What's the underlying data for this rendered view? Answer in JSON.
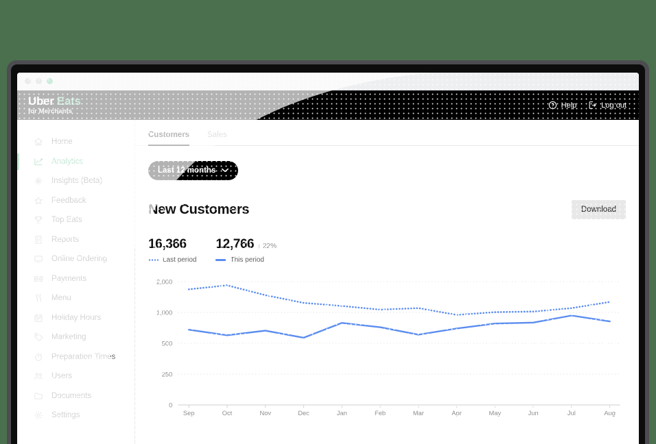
{
  "window": {
    "dots": [
      "window-dot-close",
      "window-dot-minimize",
      "window-dot-maximize"
    ]
  },
  "topbar": {
    "brand_uber": "Uber",
    "brand_eats": "Eats",
    "brand_sub": "for Merchants",
    "help_label": "Help",
    "logout_label": "Log out"
  },
  "sidebar": {
    "items": [
      {
        "label": "Home",
        "icon": "home-icon",
        "active": false
      },
      {
        "label": "Analytics",
        "icon": "analytics-icon",
        "active": true
      },
      {
        "label": "Insights (Beta)",
        "icon": "sparkle-icon",
        "active": false
      },
      {
        "label": "Feedback",
        "icon": "star-icon",
        "active": false
      },
      {
        "label": "Top Eats",
        "icon": "trophy-icon",
        "active": false
      },
      {
        "label": "Reports",
        "icon": "report-icon",
        "active": false
      },
      {
        "label": "Online Ordering",
        "icon": "monitor-icon",
        "active": false
      },
      {
        "label": "Payments",
        "icon": "cash-icon",
        "active": false
      },
      {
        "label": "Menu",
        "icon": "cutlery-icon",
        "active": false
      },
      {
        "label": "Holiday Hours",
        "icon": "calendar-icon",
        "active": false
      },
      {
        "label": "Marketing",
        "icon": "tag-icon",
        "active": false
      },
      {
        "label": "Preparation Times",
        "icon": "stopwatch-icon",
        "active": false
      },
      {
        "label": "Users",
        "icon": "users-icon",
        "active": false
      },
      {
        "label": "Documents",
        "icon": "folder-icon",
        "active": false
      },
      {
        "label": "Settings",
        "icon": "gear-icon",
        "active": false
      }
    ]
  },
  "main": {
    "tabs": [
      {
        "label": "Customers",
        "active": true
      },
      {
        "label": "Sales",
        "active": false
      }
    ],
    "period_selector": "Last 12 months",
    "page_title": "New Customers",
    "download_label": "Download",
    "stats": [
      {
        "value": "16,366",
        "delta": "",
        "legend": "Last period",
        "style": "dotted"
      },
      {
        "value": "12,766",
        "delta": "↓ 22%",
        "legend": "This period",
        "style": "solid"
      }
    ]
  },
  "colors": {
    "brand_green": "#3fae6f",
    "series_blue": "#5b8def",
    "page_background": "#4a704e",
    "topbar_black": "#000000"
  },
  "chart_data": {
    "type": "line",
    "title": "New Customers",
    "xlabel": "",
    "ylabel": "",
    "grid": true,
    "legend_position": "top-left",
    "categories": [
      "Sep",
      "Oct",
      "Nov",
      "Dec",
      "Jan",
      "Feb",
      "Mar",
      "Apr",
      "May",
      "Jun",
      "Jul",
      "Aug"
    ],
    "y_ticks": [
      0,
      250,
      500,
      1000,
      2000
    ],
    "y_tick_labels": [
      "0",
      "250",
      "500",
      "1,000",
      "2,000"
    ],
    "ylim": [
      0,
      2200
    ],
    "y_scale": "piecewise",
    "series": [
      {
        "name": "Last period",
        "style": "dotted",
        "color": "#5b8def",
        "total": "16,366",
        "values": [
          1750,
          1880,
          1560,
          1310,
          1210,
          1090,
          1140,
          960,
          1010,
          1030,
          1140,
          1340
        ]
      },
      {
        "name": "This period",
        "style": "solid",
        "color": "#5b8def",
        "total": "12,766",
        "change": "↓ 22%",
        "values": [
          720,
          630,
          705,
          590,
          830,
          760,
          640,
          740,
          820,
          835,
          950,
          855
        ]
      }
    ]
  }
}
